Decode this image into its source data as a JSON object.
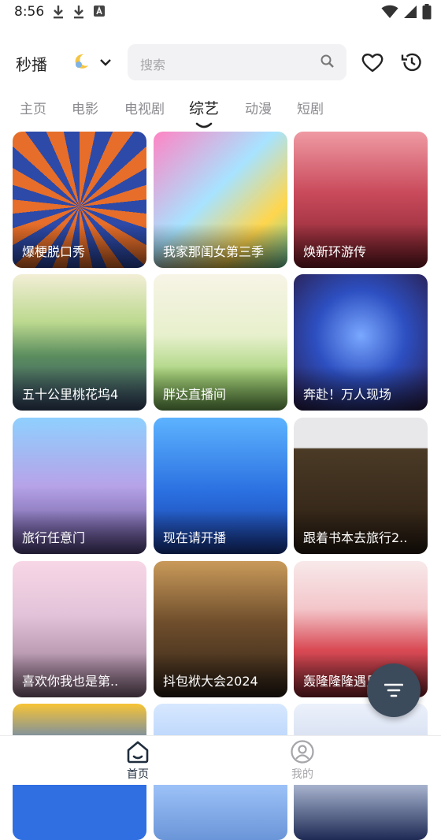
{
  "status_bar": {
    "time": "8:56",
    "left_icons": [
      "download-icon",
      "download-icon",
      "text-box-icon"
    ],
    "right_icons": [
      "wifi-icon",
      "signal-icon",
      "battery-icon"
    ]
  },
  "header": {
    "brand": "秒播",
    "search_placeholder": "搜索"
  },
  "tabs": [
    {
      "label": "主页",
      "active": false
    },
    {
      "label": "电影",
      "active": false
    },
    {
      "label": "电视剧",
      "active": false
    },
    {
      "label": "综艺",
      "active": true
    },
    {
      "label": "动漫",
      "active": false
    },
    {
      "label": "短剧",
      "active": false
    }
  ],
  "cards": [
    {
      "title": "爆梗脱口秀"
    },
    {
      "title": "我家那闺女第三季"
    },
    {
      "title": "焕新环游传"
    },
    {
      "title": "五十公里桃花坞4"
    },
    {
      "title": "胖达直播间"
    },
    {
      "title": "奔赴！万人现场"
    },
    {
      "title": "旅行任意门"
    },
    {
      "title": "现在请开播"
    },
    {
      "title": "跟着书本去旅行2.."
    },
    {
      "title": "喜欢你我也是第.."
    },
    {
      "title": "抖包袱大会2024"
    },
    {
      "title": "轰隆隆隆遇见你"
    },
    {
      "title": ""
    },
    {
      "title": ""
    },
    {
      "title": ""
    }
  ],
  "bottom_nav": [
    {
      "label": "首页",
      "icon": "home-icon",
      "active": true
    },
    {
      "label": "我的",
      "icon": "profile-icon",
      "active": false
    }
  ],
  "colors": {
    "accent": "#1f2d3d",
    "inactive": "#9a9a9e",
    "fab": "#3c4b5c"
  }
}
